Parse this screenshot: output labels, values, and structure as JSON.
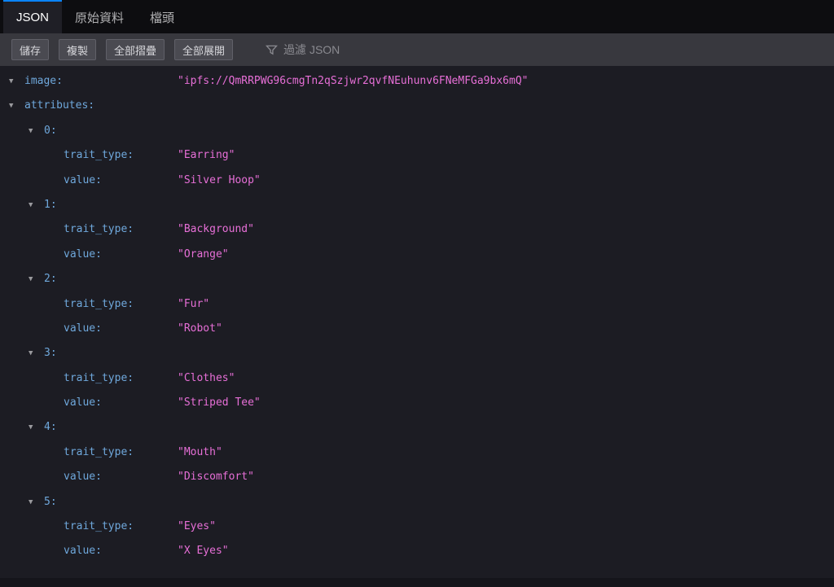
{
  "tabs": [
    {
      "label": "JSON"
    },
    {
      "label": "原始資料"
    },
    {
      "label": "檔頭"
    }
  ],
  "toolbar": {
    "save": "儲存",
    "copy": "複製",
    "collapse_all": "全部摺疊",
    "expand_all": "全部展開",
    "filter_placeholder": "過濾 JSON"
  },
  "tree": {
    "image": {
      "key": "image:",
      "value": "\"ipfs://QmRRPWG96cmgTn2qSzjwr2qvfNEuhunv6FNeMFGa9bx6mQ\""
    },
    "attributes_key": "attributes:",
    "labels": {
      "trait_type": "trait_type:",
      "value": "value:"
    },
    "attributes": [
      {
        "index": "0:",
        "trait_type": "\"Earring\"",
        "value": "\"Silver Hoop\""
      },
      {
        "index": "1:",
        "trait_type": "\"Background\"",
        "value": "\"Orange\""
      },
      {
        "index": "2:",
        "trait_type": "\"Fur\"",
        "value": "\"Robot\""
      },
      {
        "index": "3:",
        "trait_type": "\"Clothes\"",
        "value": "\"Striped Tee\""
      },
      {
        "index": "4:",
        "trait_type": "\"Mouth\"",
        "value": "\"Discomfort\""
      },
      {
        "index": "5:",
        "trait_type": "\"Eyes\"",
        "value": "\"X Eyes\""
      }
    ]
  },
  "colors": {
    "accent_blue": "#0a84ff",
    "key_color": "#6fa8dc",
    "string_color": "#e76fd7"
  }
}
